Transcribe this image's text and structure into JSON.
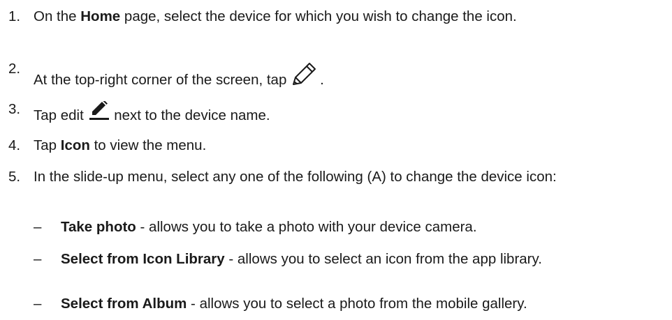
{
  "steps": [
    {
      "num": "1.",
      "pre": "On the ",
      "bold": "Home",
      "post": " page, select the device for which you wish to change the icon."
    },
    {
      "num": "2.",
      "pre": "At the top-right corner of the screen, tap",
      "icon": "pencil-outline-icon",
      "post": "."
    },
    {
      "num": "3.",
      "pre": "Tap edit",
      "icon": "edit-pencil-underline-icon",
      "post": "next to the device name."
    },
    {
      "num": "4.",
      "pre": "Tap ",
      "bold": "Icon",
      "post": " to view the menu."
    },
    {
      "num": "5.",
      "pre": "In the slide-up menu, select any one of the following (A) to change the device icon:"
    }
  ],
  "options": [
    {
      "dash": "–",
      "bold": "Take photo",
      "text": " - allows you to take a photo with your device camera."
    },
    {
      "dash": "–",
      "bold": "Select from Icon Library",
      "text": " - allows you to select an icon from the app library."
    },
    {
      "dash": "–",
      "bold": "Select from Album",
      "text": " - allows you to select a photo from the mobile gallery."
    }
  ]
}
